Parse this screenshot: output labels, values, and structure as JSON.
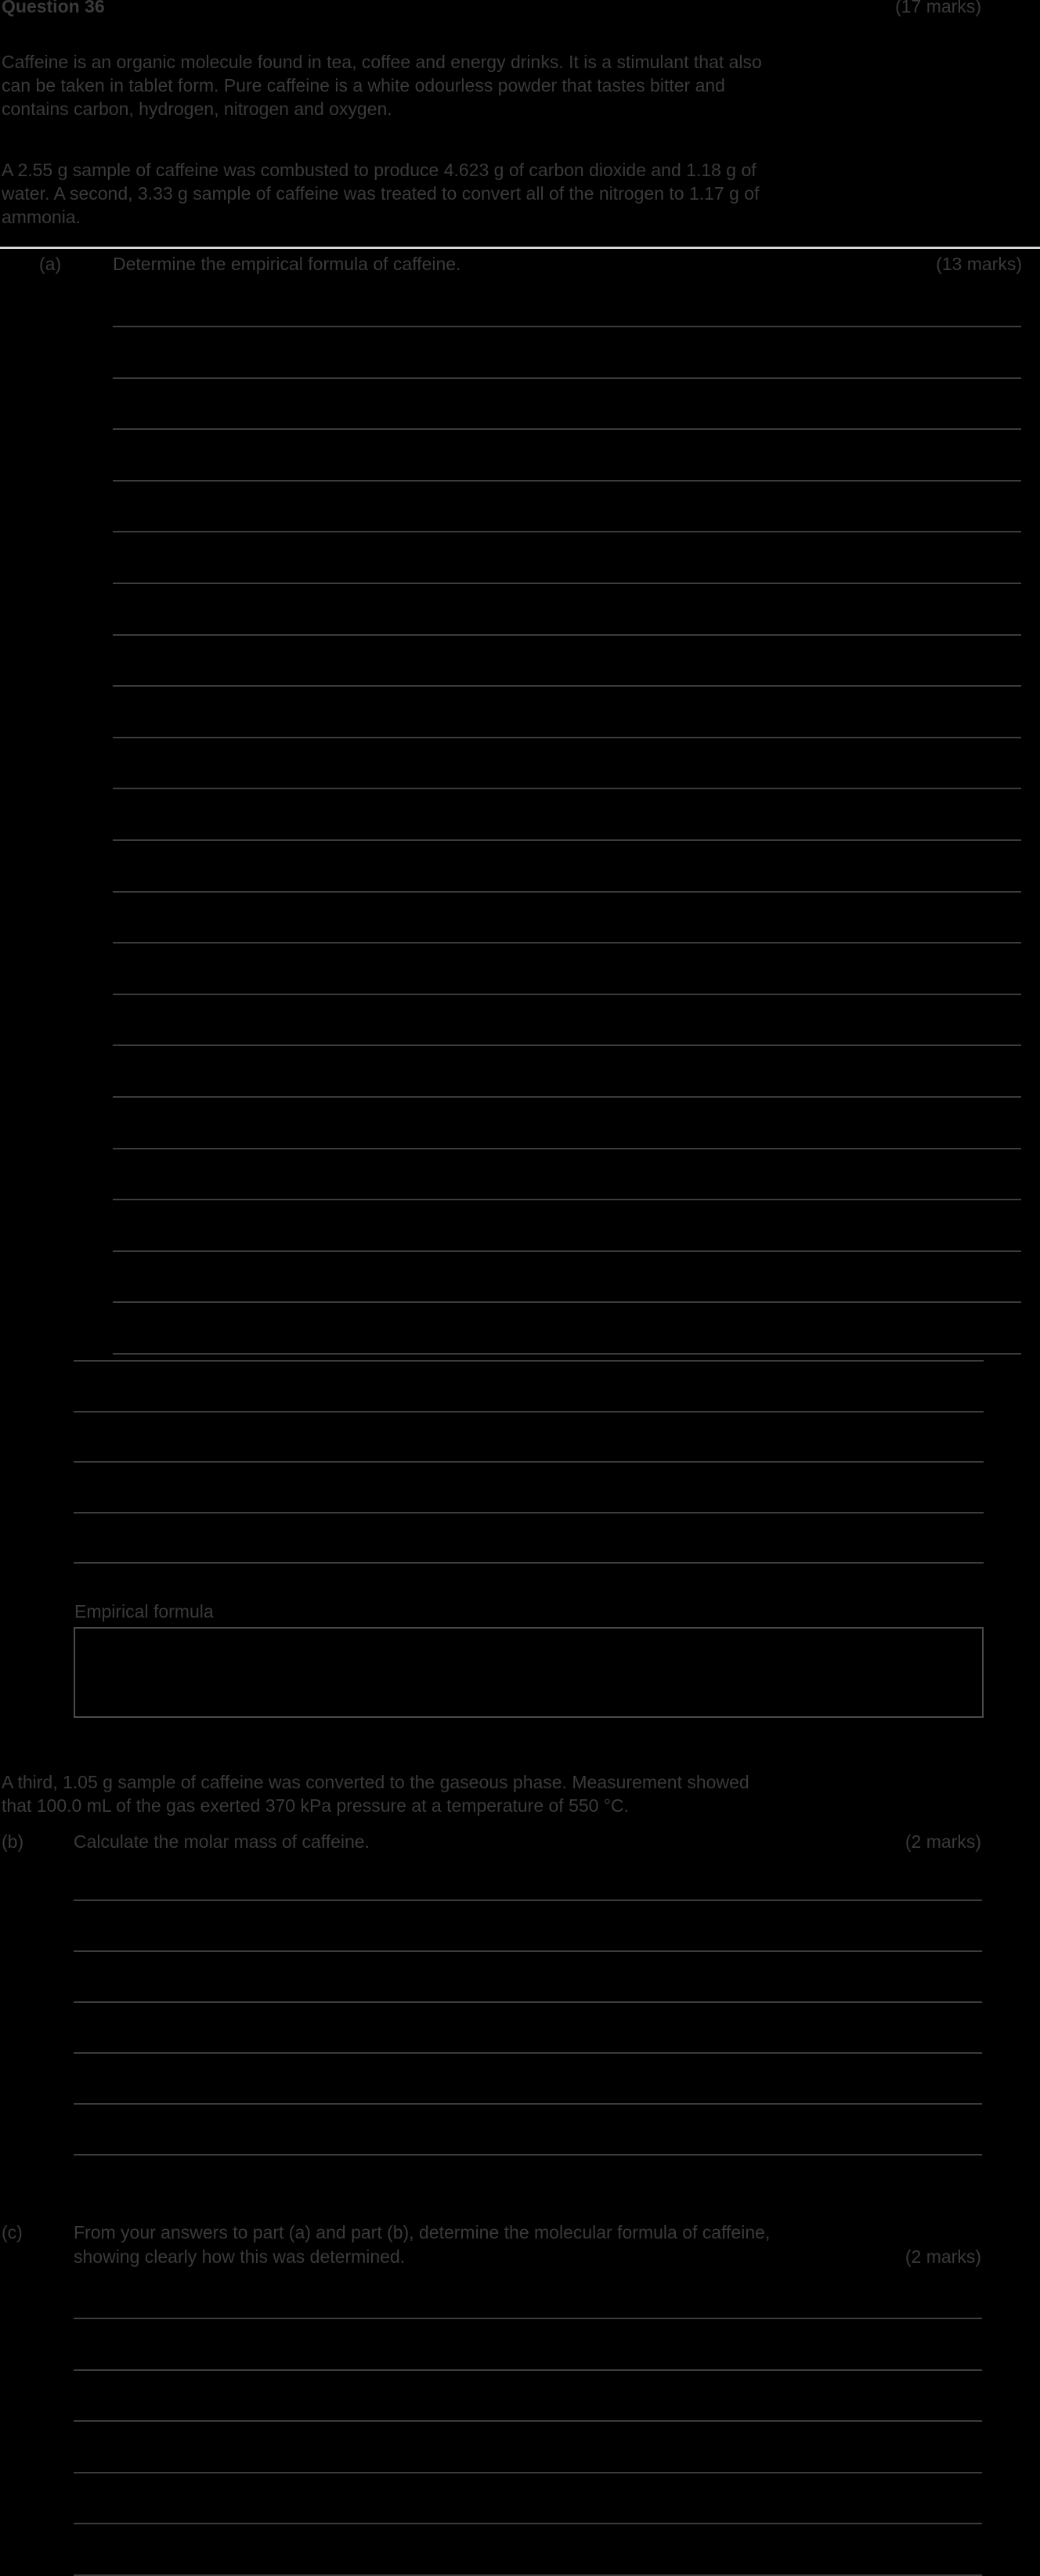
{
  "header": {
    "question_label": "Question 36",
    "total_marks": "(17 marks)"
  },
  "intro": {
    "para1": [
      "Caffeine is an organic molecule found in tea, coffee and energy drinks. It is a stimulant that also",
      "can be taken in tablet form. Pure caffeine is a white odourless powder that tastes bitter and",
      "contains carbon, hydrogen, nitrogen and oxygen."
    ],
    "para2": [
      "A 2.55 g sample of caffeine was combusted to produce 4.623 g of carbon dioxide and 1.18 g of",
      "water. A second, 3.33 g sample of caffeine was treated to convert all of the nitrogen to 1.17 g of",
      "ammonia."
    ]
  },
  "part_a": {
    "label": "(a)",
    "question": "Determine the empirical formula of caffeine.",
    "marks": "(13 marks)",
    "answer_box_label": "Empirical formula"
  },
  "part_b": {
    "preamble": [
      "A third, 1.05 g sample of caffeine was converted to the gaseous phase. Measurement showed",
      "that 100.0 mL of the gas exerted 370 kPa pressure at a temperature of 550 °C."
    ],
    "label": "(b)",
    "question": "Calculate the molar mass of caffeine.",
    "marks": "(2 marks)"
  },
  "part_c": {
    "label": "(c)",
    "question": [
      "From your answers to part (a) and part (b), determine the molecular formula of caffeine,",
      "showing clearly how this was determined."
    ],
    "marks": "(2 marks)"
  }
}
